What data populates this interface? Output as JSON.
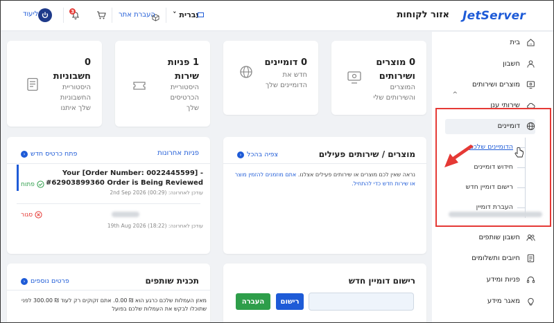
{
  "header": {
    "logo": "JetServer",
    "page_title": "אזור לקוחות",
    "language": "עברית",
    "transfer_label": "העברת אתר",
    "notifications_count": "3",
    "logout_label": "ליעוד"
  },
  "sidebar": {
    "items": [
      {
        "label": "בית",
        "icon": "home-icon"
      },
      {
        "label": "חשבון",
        "icon": "user-icon"
      },
      {
        "label": "מוצרים ושירותים",
        "icon": "monitor-icon"
      },
      {
        "label": "שירותי ענן",
        "icon": "cloud-icon"
      },
      {
        "label": "דומיינים",
        "icon": "globe-icon"
      },
      {
        "label": "חשבון שותפים",
        "icon": "users-icon"
      },
      {
        "label": "חיובים ותשלומים",
        "icon": "receipt-icon"
      },
      {
        "label": "פניות ומידע",
        "icon": "headset-icon"
      },
      {
        "label": "מאגר מידע",
        "icon": "bulb-icon"
      }
    ],
    "domain_submenu": [
      {
        "label": "הדומיינים שלכם",
        "active": true
      },
      {
        "label": "חידוש דומיינים"
      },
      {
        "label": "רישום דומיין חדש"
      },
      {
        "label": "העברת דומיין"
      }
    ]
  },
  "stats": [
    {
      "title": "0 מוצרים ושירותים",
      "line1": "המוצרים",
      "line2": "והשירותים שלי"
    },
    {
      "title": "0 דומיינים",
      "line1": "חדש את",
      "line2": "הדומיינים שלך"
    },
    {
      "title": "1 פניות שירות",
      "line1": "היסטוריית",
      "line2": "הכרטיסים",
      "line3": "שלך"
    },
    {
      "title": "0 חשבוניות",
      "line1": "היסטוריית",
      "line2": "החשבוניות",
      "line3": "שלך איתנו"
    }
  ],
  "products_panel": {
    "title": "מוצרים / שירותים פעילים",
    "link": "צפיה בהכל",
    "note": "נראה שאין לכם מוצרים או שירותים פעילים אצלנו.",
    "note_link": "אתם מוזמנים להזמין מוצר או שירות חדש כדי להתחיל."
  },
  "tickets_panel": {
    "title": "פניות אחרונות",
    "link": "פתח כרטיס חדש",
    "tickets": [
      {
        "title": "Your [Order Number: 0022445599] - #62903899360 Order is Being Reviewed",
        "meta": "עודכן לאחרונה: 2nd Sep 2026 (00:29)",
        "status": "פתוח",
        "status_color": "#2e9e4a"
      },
      {
        "meta": "עודכן לאחרונה: 19th Aug 2026 (18:22)",
        "status": "סגור",
        "status_color": "#e53935"
      }
    ]
  },
  "domain_register": {
    "title": "רישום דומיין חדש",
    "register_btn": "רישום",
    "transfer_btn": "העברה"
  },
  "affiliate": {
    "title": "תכנית שותפים",
    "link": "פרטים נוספים",
    "note": "מאזן העמלות שלכם כרגע הוא ₪ 0.00. אתם זקוקים רק לעוד ₪ 300.00 לפני שתוכלו לבקש את העמלות שלכם בפועל"
  },
  "colors": {
    "accent": "#1e5bd7",
    "highlight_frame": "#e53935",
    "button_blue": "#1e5bd7",
    "button_green": "#2e9e4a"
  }
}
